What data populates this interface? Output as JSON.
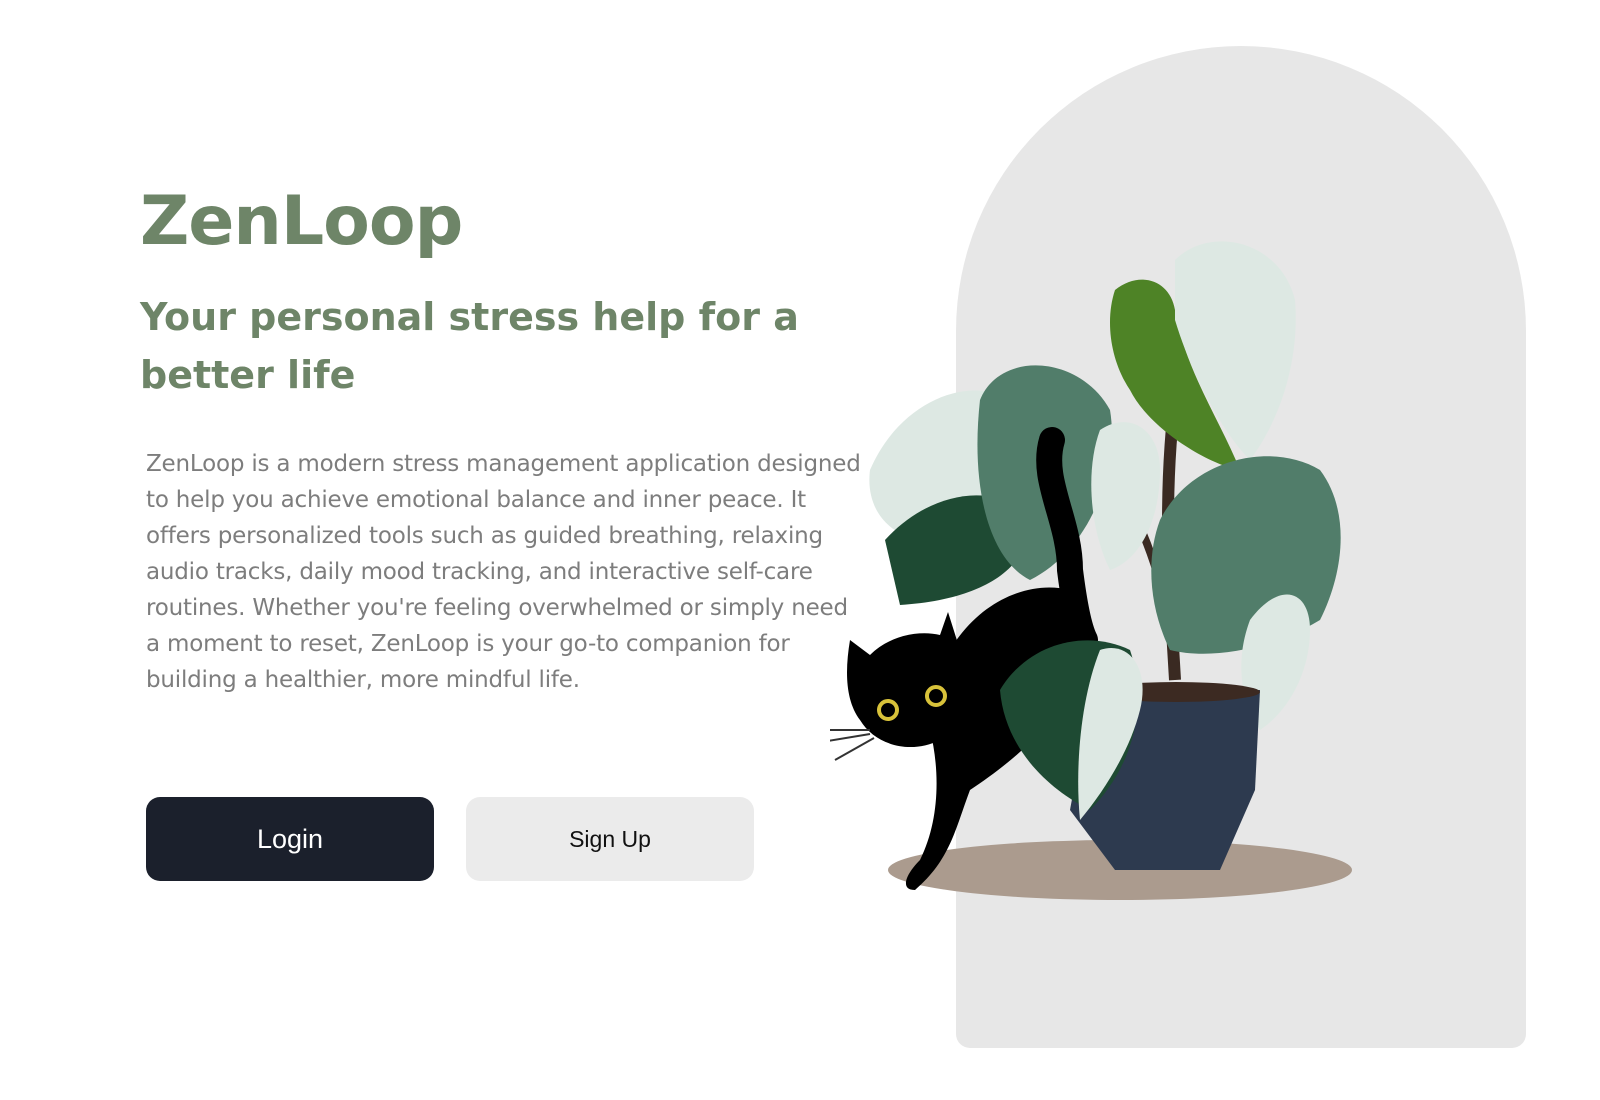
{
  "app": {
    "title": "ZenLoop",
    "tagline": "Your personal stress help for a better life",
    "description": "ZenLoop is a modern stress management application designed to help you achieve emotional balance and inner peace. It offers personalized tools such as guided breathing, relaxing audio tracks, daily mood tracking, and interactive self-care routines. Whether you're feeling overwhelmed or simply need a moment to reset, ZenLoop is your go-to companion for building a healthier, more mindful life."
  },
  "buttons": {
    "login_label": "Login",
    "signup_label": "Sign Up"
  },
  "colors": {
    "brand_green": "#6e8568",
    "body_text": "#7d7d7d",
    "login_bg": "#1b202c",
    "signup_bg": "#ebebeb",
    "arch_bg": "#e7e7e7"
  },
  "illustration": {
    "icon": "cat-and-monstera-plant-illustration"
  }
}
